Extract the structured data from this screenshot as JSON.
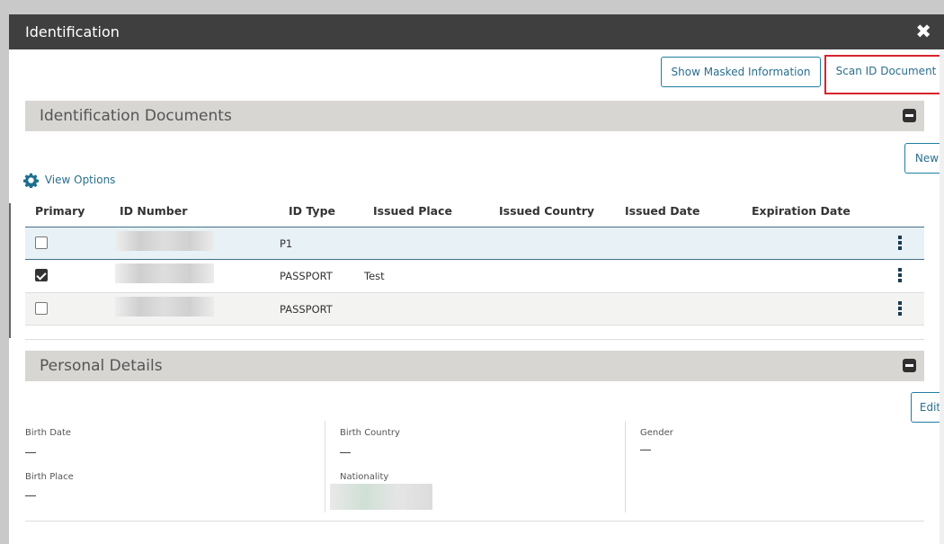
{
  "dialog": {
    "title": "Identification",
    "close_glyph": "✖"
  },
  "toolbar": {
    "show_masked_label": "Show Masked Information",
    "scan_id_label": "Scan ID Document"
  },
  "id_docs": {
    "header": "Identification Documents",
    "new_label": "New",
    "view_options_label": "View Options",
    "columns": [
      "Primary",
      "ID Number",
      "ID Type",
      "Issued Place",
      "Issued Country",
      "Issued Date",
      "Expiration Date"
    ],
    "rows": [
      {
        "primary": false,
        "id_type": "P1",
        "issued_place": ""
      },
      {
        "primary": true,
        "id_type": "PASSPORT",
        "issued_place": "Test"
      },
      {
        "primary": false,
        "id_type": "PASSPORT",
        "issued_place": ""
      }
    ]
  },
  "personal": {
    "header": "Personal Details",
    "edit_label": "Edit",
    "birth_date_label": "Birth Date",
    "birth_date_value": "—",
    "birth_place_label": "Birth Place",
    "birth_place_value": "—",
    "birth_country_label": "Birth Country",
    "birth_country_value": "—",
    "nationality_label": "Nationality",
    "gender_label": "Gender",
    "gender_value": "—"
  },
  "colors": {
    "accent": "#1f7ea1",
    "titlebar": "#3f3f3f",
    "section_header": "#d8d6d3",
    "highlight": "#d9232d"
  },
  "icons": [
    "close-icon",
    "gear-icon",
    "collapse-icon",
    "kebab-menu-icon",
    "checkbox"
  ]
}
